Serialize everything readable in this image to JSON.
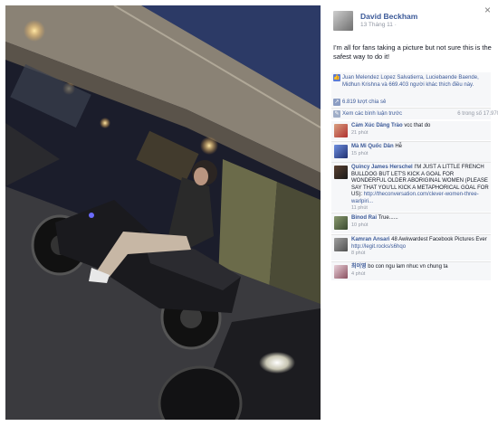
{
  "viewer": {
    "close_label": "×"
  },
  "post": {
    "author": "David Beckham",
    "time": "13 Tháng 11 ·",
    "text": "I'm all for fans taking a picture but not sure this is the safest way to do it!"
  },
  "ufi": {
    "likes_text": "Juan Melendez Lopez Salvatierra, Luciebaende Baende, Midhun Krishna và 669.403 người khác thích điều này.",
    "shares_text": "6.819 lượt chia sẻ",
    "previous_comments_label": "Xem các bình luận trước",
    "comment_count": "6 trong số 17.970"
  },
  "comments": [
    {
      "name": "Cảm Xúc Dâng Trào",
      "text": "vcc that do",
      "time": "21 phút"
    },
    {
      "name": "Mà Mi Quốc Dân",
      "text": "Hễ",
      "time": "15 phút"
    },
    {
      "name": "Quincy James Herschel",
      "text": "I'M JUST A LITTLE FRENCH BULLDOG BUT LET'S KICK A GOAL FOR WONDERFUL OLDER ABORIGINAL WOMEN (PLEASE SAY THAT YOU'LL KICK A METAPHORICAL GOAL FOR US):",
      "link": "http://theconversation.com/clever-women-three-warlpiri...",
      "time": "11 phút"
    },
    {
      "name": "Binod Rai",
      "text": "True......",
      "time": "10 phút"
    },
    {
      "name": "Kamran Ansari",
      "text": "48 Awkwardest Facebook Pictures Ever",
      "link": "http://legit.rocks/s6hqo",
      "time": "8 phút"
    },
    {
      "name": "최이영",
      "text": "bo con ngu lam nhuc vn chung ta",
      "time": "4 phút"
    }
  ],
  "colors": {
    "link": "#3b5998",
    "ufi_bg": "#f6f7f9",
    "meta": "#9197a3"
  }
}
